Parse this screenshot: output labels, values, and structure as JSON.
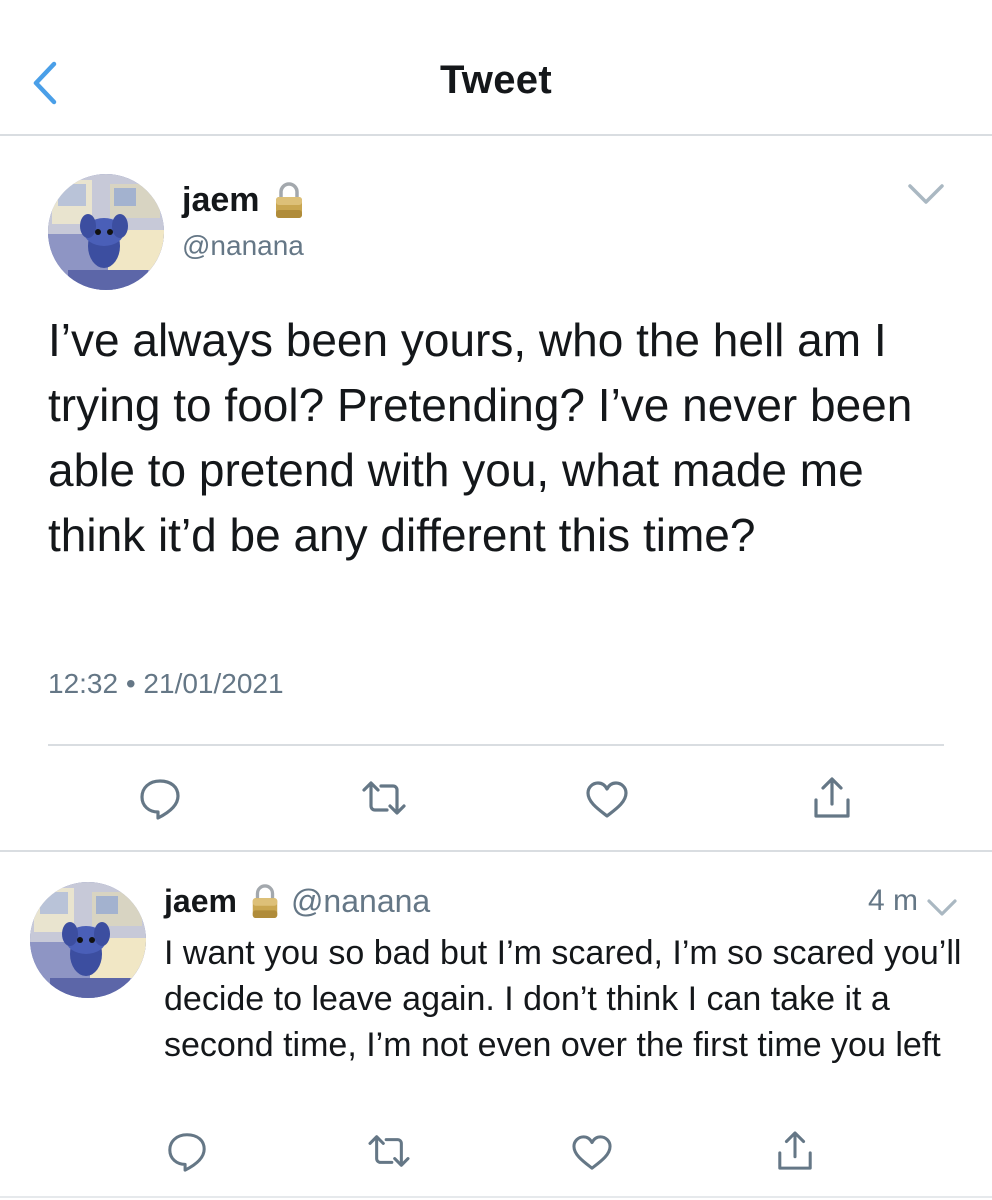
{
  "header": {
    "title": "Tweet",
    "back_icon": "chevron-left-icon"
  },
  "main_tweet": {
    "display_name": "jaem",
    "handle": "@nanana",
    "protected_icon": "lock-icon",
    "text": "I’ve always been yours, who the hell am I trying to fool? Pretending? I’ve never been able to pretend with you, what made me think it’d be any different this time?",
    "timestamp": "12:32 • 21/01/2021",
    "actions": [
      "reply-icon",
      "retweet-icon",
      "like-icon",
      "share-icon"
    ]
  },
  "reply_tweet": {
    "display_name": "jaem",
    "handle": "@nanana",
    "time_ago": "4 m",
    "text": "I want you so bad but I’m scared, I’m so scared you’ll decide to leave again. I don’t think I can take it a second time, I’m not even over the first time you left",
    "actions": [
      "reply-icon",
      "retweet-icon",
      "like-icon",
      "share-icon"
    ]
  },
  "colors": {
    "accent": "#1da1f2",
    "icon_gray": "#657786",
    "text": "#14171a",
    "divider": "#d9dde1"
  }
}
